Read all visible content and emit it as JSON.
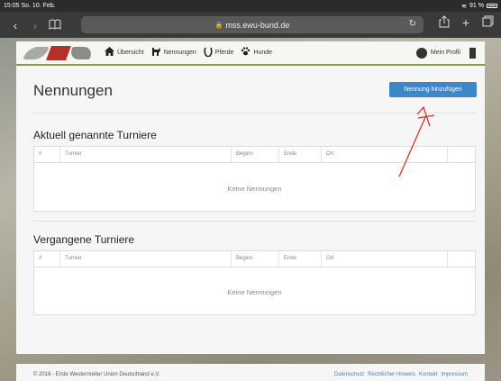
{
  "status_bar": {
    "time": "15:05",
    "date": "So. 10. Feb.",
    "battery": "91 %"
  },
  "browser": {
    "url": "mss.ewu-bund.de"
  },
  "nav": {
    "items": [
      {
        "label": "Übersicht",
        "icon": "home-icon"
      },
      {
        "label": "Nennungen",
        "icon": "horse-rider-icon"
      },
      {
        "label": "Pferde",
        "icon": "horseshoe-icon"
      },
      {
        "label": "Hunde",
        "icon": "paw-icon"
      }
    ],
    "profile_label": "Mein Profil"
  },
  "page": {
    "title": "Nennungen",
    "add_button": "Nennung hinzufügen"
  },
  "sections": [
    {
      "title": "Aktuell genannte Turniere",
      "columns": [
        "#",
        "Turnier",
        "Beginn",
        "Ende",
        "Ort",
        ""
      ],
      "empty_text": "Keine Nennungen"
    },
    {
      "title": "Vergangene Turniere",
      "columns": [
        "#",
        "Turnier",
        "Beginn",
        "Ende",
        "Ort",
        ""
      ],
      "empty_text": "Keine Nennungen"
    }
  ],
  "footer": {
    "copyright": "© 2018 - Erste Westernreiter Union Deutschland e.V.",
    "links": [
      "Datenschutz",
      "Rechtlicher Hinweis",
      "Kontakt",
      "Impressum"
    ]
  },
  "colors": {
    "accent": "#3f86c8",
    "brand_green": "#7aa83b",
    "annotation_red": "#e0322a"
  }
}
